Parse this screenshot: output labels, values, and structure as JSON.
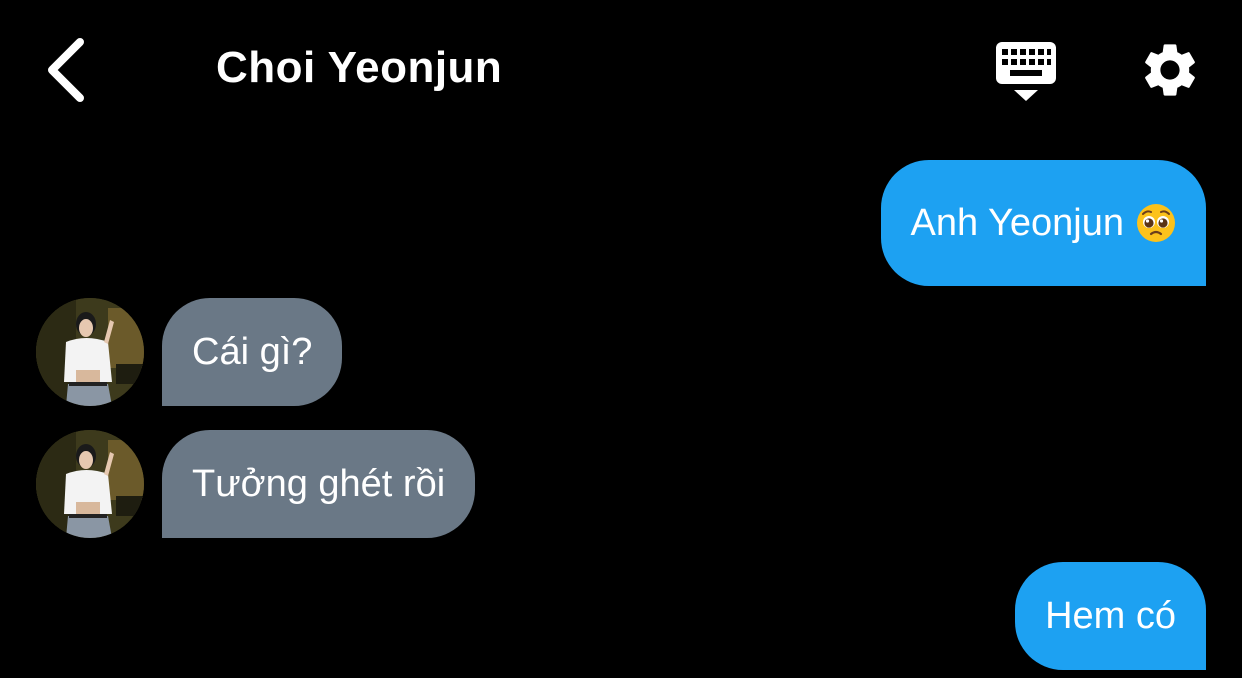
{
  "header": {
    "title": "Choi Yeonjun",
    "back_icon": "chevron-left-icon",
    "keyboard_icon": "keyboard-icon",
    "settings_icon": "gear-icon"
  },
  "messages": [
    {
      "direction": "outgoing",
      "text": "Anh Yeonjun",
      "emoji": "pleading-face-emoji"
    },
    {
      "direction": "incoming",
      "text": "Cái gì?"
    },
    {
      "direction": "incoming",
      "text": "Tưởng ghét rồi"
    },
    {
      "direction": "outgoing",
      "text": "Hem có"
    }
  ],
  "colors": {
    "background": "#000000",
    "outgoing_bubble": "#1da1f2",
    "incoming_bubble": "#6a7886",
    "text": "#ffffff"
  }
}
